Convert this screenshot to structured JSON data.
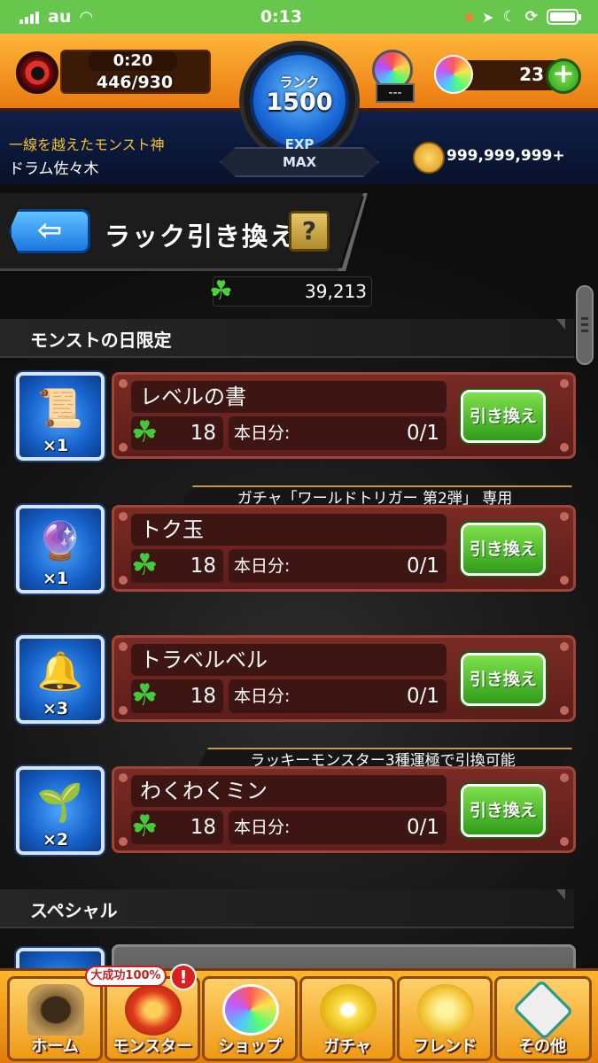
{
  "status_bar": {
    "carrier": "au",
    "time": "0:13"
  },
  "header": {
    "stamina_timer": "0:20",
    "stamina": "446/930",
    "rank_label": "ランク",
    "rank": "1500",
    "exp_line1": "EXP",
    "exp_line2": "MAX",
    "item_label": "---",
    "orb_count": "23",
    "plus": "+",
    "title": "一線を越えたモンスト神",
    "player_name": "ドラム佐々木",
    "coins": "999,999,999+"
  },
  "page": {
    "back_arrow": "⇦",
    "title": "ラック引き換え",
    "help": "?",
    "clover_total": "39,213"
  },
  "sections": [
    {
      "title": "モンストの日限定"
    },
    {
      "title": "スペシャル"
    }
  ],
  "items": [
    {
      "name": "レベルの書",
      "count": "×1",
      "icon": "scroll-icon",
      "glyph": "📜",
      "cost": "18",
      "quota_label": "本日分:",
      "quota": "0/1",
      "button": "引き換え",
      "ribbon": ""
    },
    {
      "name": "トク玉",
      "count": "×1",
      "icon": "orb-icon",
      "glyph": "🔮",
      "cost": "18",
      "quota_label": "本日分:",
      "quota": "0/1",
      "button": "引き換え",
      "ribbon": "ガチャ「ワールドトリガー 第2弾」 専用"
    },
    {
      "name": "トラベルベル",
      "count": "×3",
      "icon": "bell-icon",
      "glyph": "🔔",
      "cost": "18",
      "quota_label": "本日分:",
      "quota": "0/1",
      "button": "引き換え",
      "ribbon": ""
    },
    {
      "name": "わくわくミン",
      "count": "×2",
      "icon": "bottle-icon",
      "glyph": "🌱",
      "cost": "18",
      "quota_label": "本日分:",
      "quota": "0/1",
      "button": "引き換え",
      "ribbon": "ラッキーモンスター3種運極で引換可能"
    }
  ],
  "nav": {
    "badge": "大成功100%",
    "alert": "!",
    "items": [
      {
        "label": "ホーム",
        "icon": "home-icon"
      },
      {
        "label": "モンスター",
        "icon": "monster-icon"
      },
      {
        "label": "ショップ",
        "icon": "shop-icon"
      },
      {
        "label": "ガチャ",
        "icon": "gacha-icon"
      },
      {
        "label": "フレンド",
        "icon": "friend-icon"
      },
      {
        "label": "その他",
        "icon": "other-icon"
      }
    ]
  },
  "colors": {
    "accent_orange": "#f7a21b",
    "status_green": "#66c74c",
    "button_green": "#4cc02a",
    "panel_red": "#6e2520",
    "rank_blue": "#1867d6"
  }
}
